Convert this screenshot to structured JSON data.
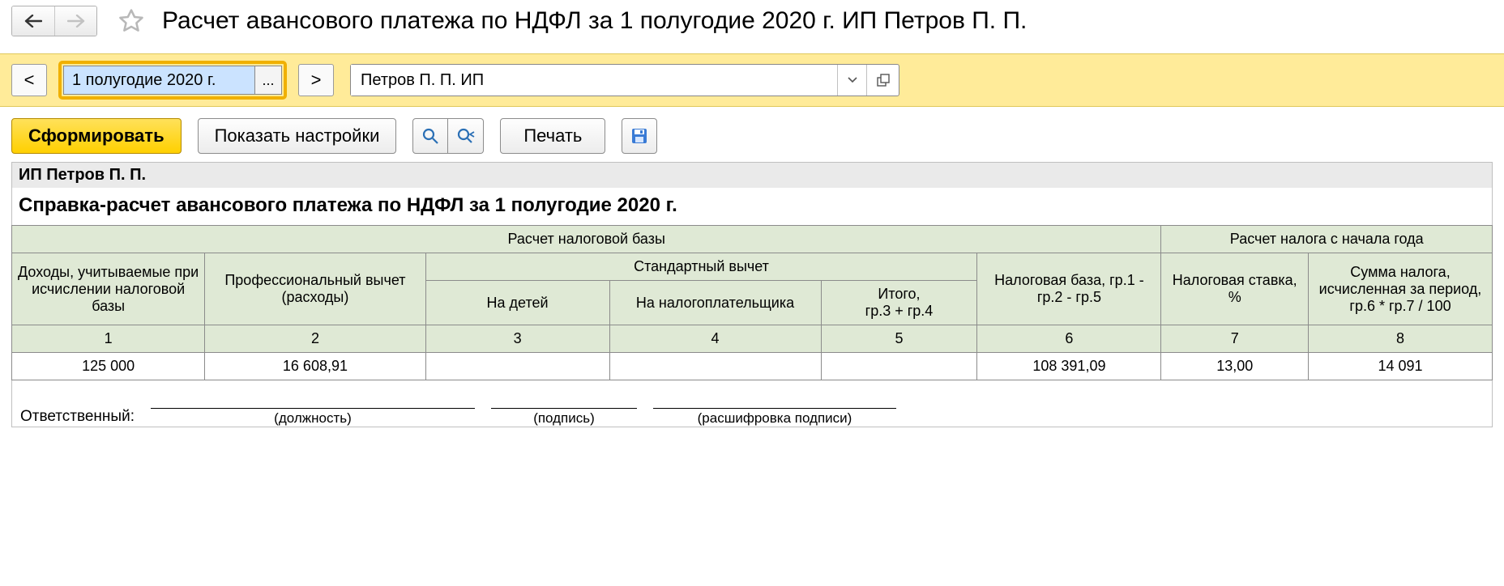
{
  "header": {
    "title": "Расчет авансового платежа по НДФЛ за 1 полугодие 2020 г. ИП Петров П. П."
  },
  "filters": {
    "prev": "<",
    "next": ">",
    "period_value": "1 полугодие 2020 г.",
    "period_ellipsis": "...",
    "entity_value": "Петров П. П. ИП"
  },
  "toolbar": {
    "generate": "Сформировать",
    "show_settings": "Показать настройки",
    "print": "Печать"
  },
  "report": {
    "org": "ИП Петров П. П.",
    "title": "Справка-расчет авансового платежа по НДФЛ за 1 полугодие 2020 г.",
    "group_base": "Расчет налоговой базы",
    "group_tax": "Расчет налога с начала года",
    "col1": "Доходы, учитываемые при исчислении налоговой базы",
    "col2": "Профессиональный вычет (расходы)",
    "std_group": "Стандартный вычет",
    "col3": "На детей",
    "col4": "На налогоплательщика",
    "col5": "Итого,\nгр.3 + гр.4",
    "col6": "Налоговая база, гр.1 - гр.2 - гр.5",
    "col7": "Налоговая ставка, %",
    "col8": "Сумма налога, исчисленная за период,\nгр.6 * гр.7 / 100",
    "n1": "1",
    "n2": "2",
    "n3": "3",
    "n4": "4",
    "n5": "5",
    "n6": "6",
    "n7": "7",
    "n8": "8",
    "v1": "125 000",
    "v2": "16 608,91",
    "v3": "",
    "v4": "",
    "v5": "",
    "v6": "108 391,09",
    "v7": "13,00",
    "v8": "14 091"
  },
  "signature": {
    "label": "Ответственный:",
    "position": "(должность)",
    "sign": "(подпись)",
    "fullname": "(расшифровка подписи)"
  }
}
